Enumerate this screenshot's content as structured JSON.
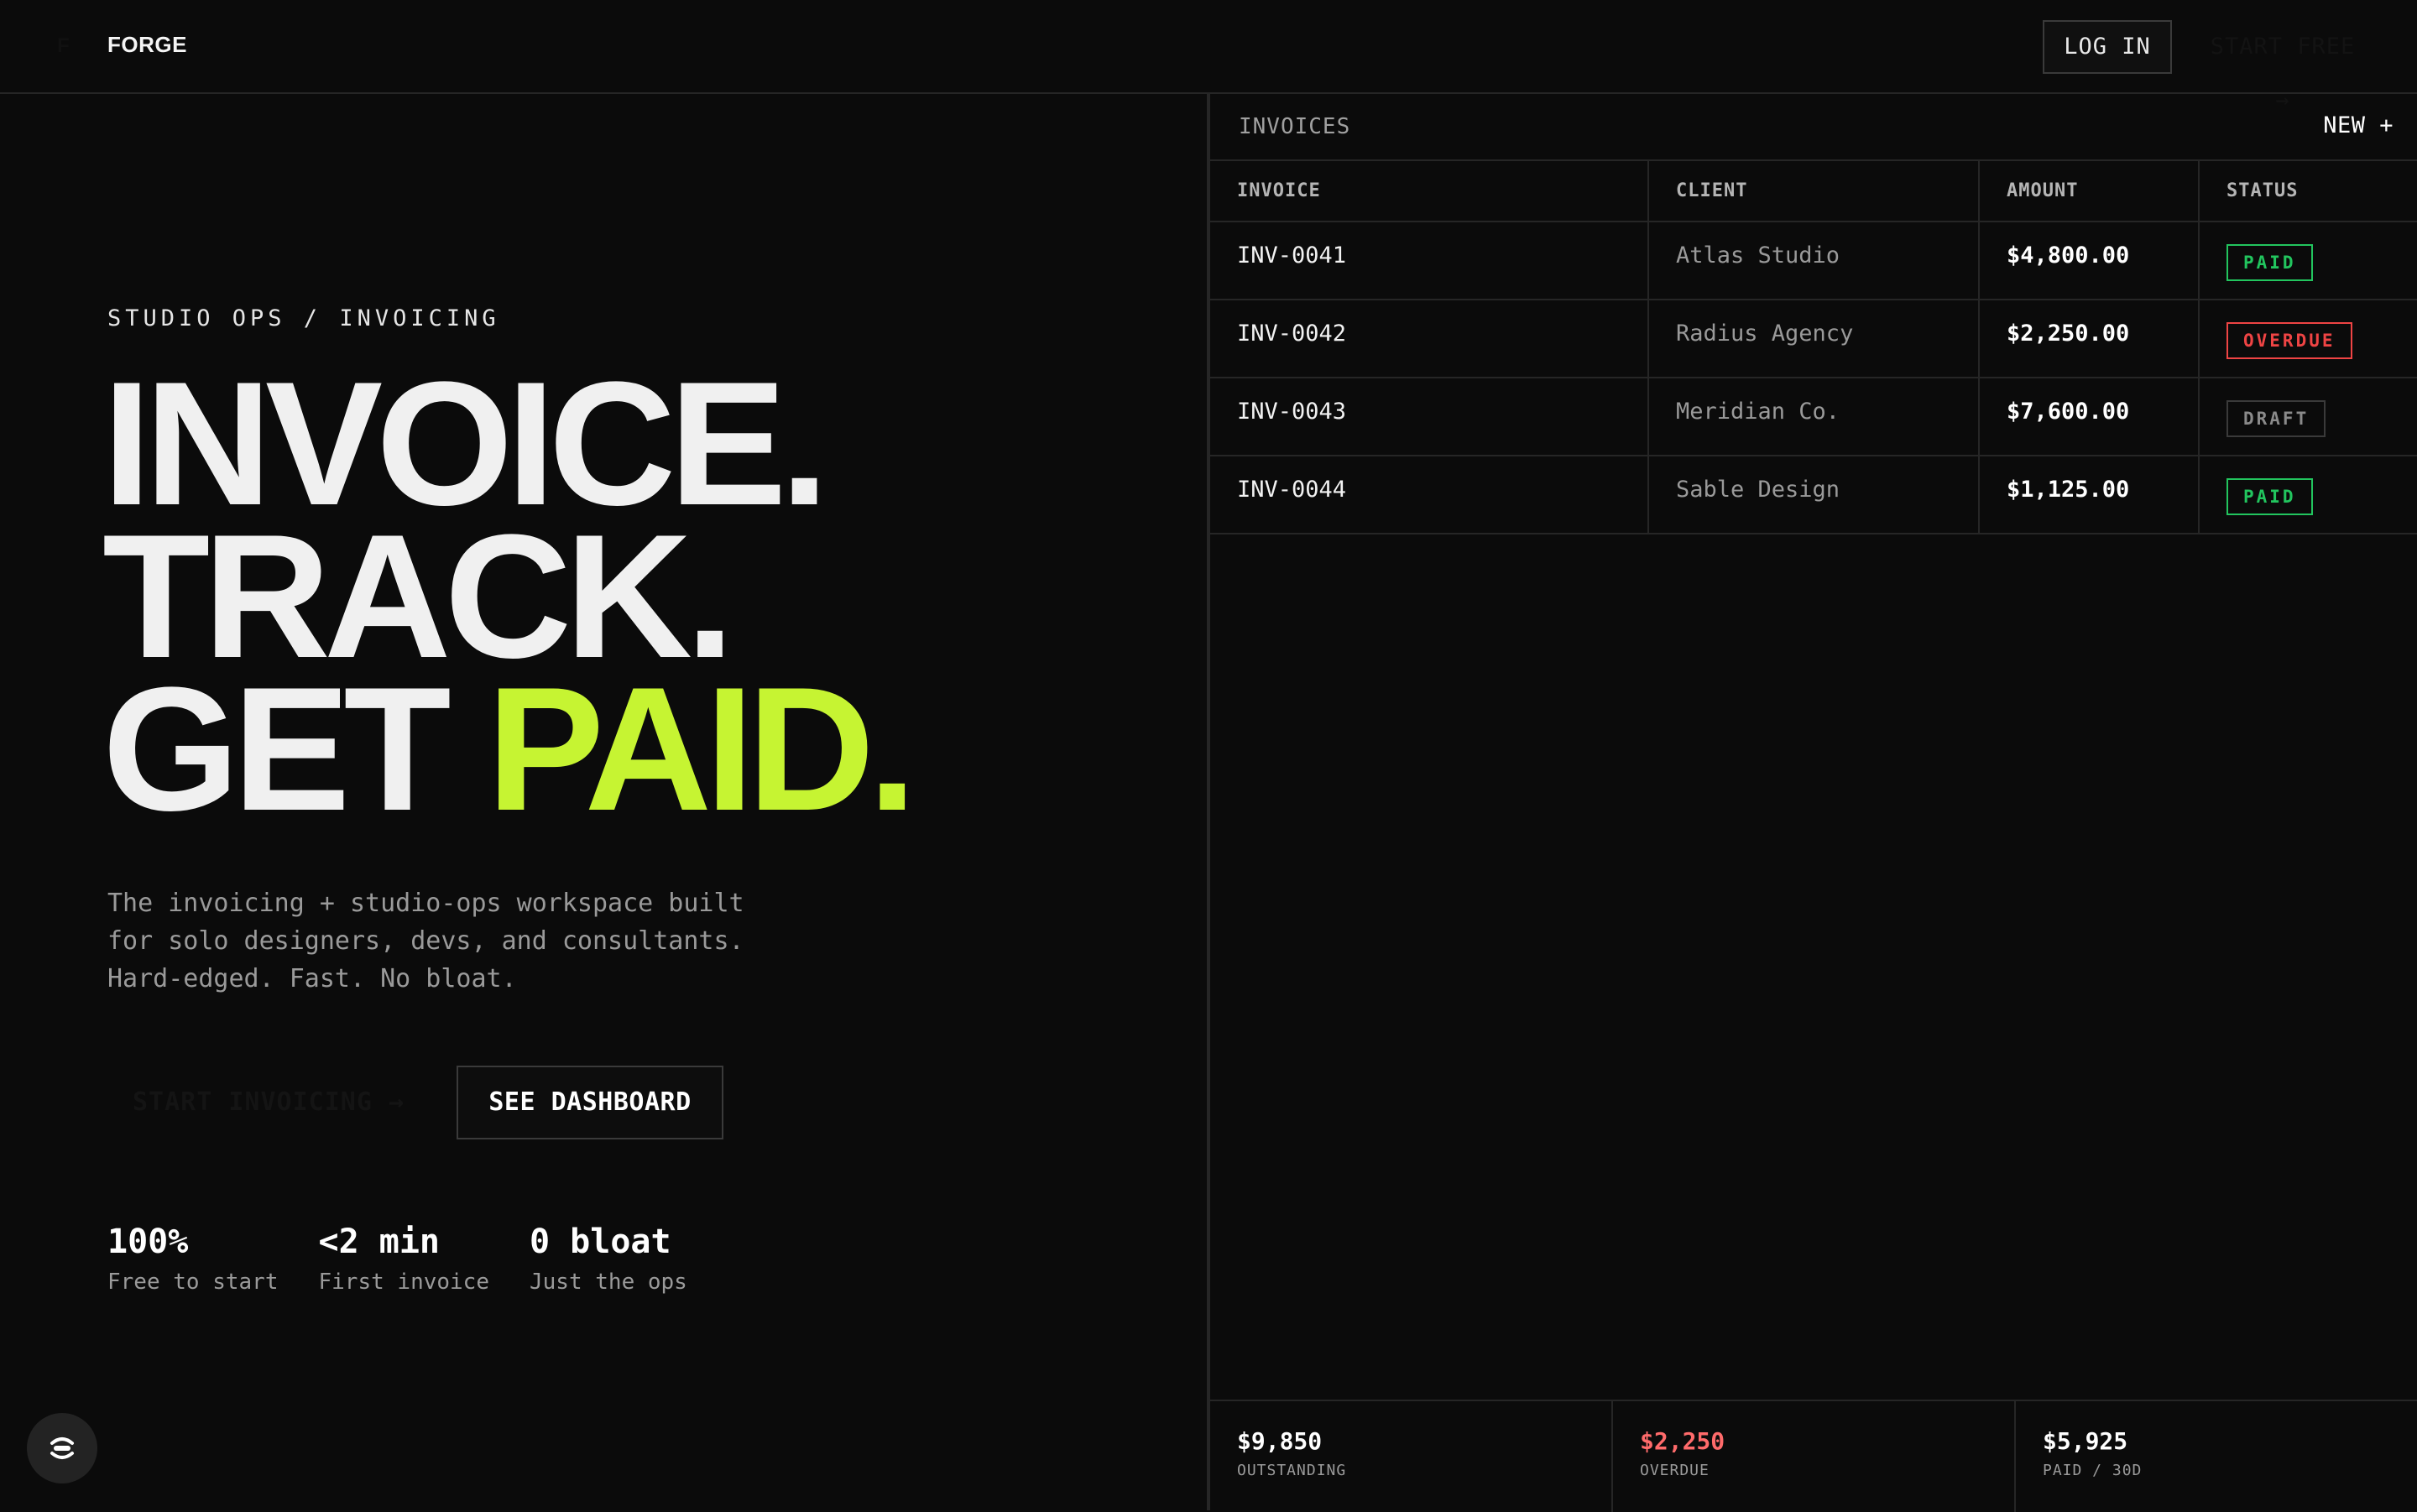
{
  "header": {
    "logo_mark": "F",
    "logo_text": "FORGE",
    "login_label": "LOG IN",
    "start_free_label": "START FREE →"
  },
  "hero": {
    "eyebrow": "STUDIO OPS / INVOICING",
    "headline_line1": "INVOICE.",
    "headline_line2": "TRACK.",
    "headline_line3_prefix": "GET ",
    "headline_line3_accent": "PAID.",
    "subcopy": "The invoicing + studio-ops workspace built for solo designers, devs, and consultants. Hard-edged. Fast. No bloat.",
    "cta_primary": "START INVOICING →",
    "cta_secondary": "SEE DASHBOARD",
    "stats": [
      {
        "value": "100%",
        "label": "Free to start"
      },
      {
        "value": "<2 min",
        "label": "First invoice"
      },
      {
        "value": "0 bloat",
        "label": "Just the ops"
      }
    ]
  },
  "panel": {
    "title": "INVOICES",
    "new_label": "NEW +",
    "columns": [
      "INVOICE",
      "CLIENT",
      "AMOUNT",
      "STATUS"
    ],
    "rows": [
      {
        "invoice": "INV-0041",
        "client": "Atlas Studio",
        "amount": "$4,800.00",
        "status": "PAID"
      },
      {
        "invoice": "INV-0042",
        "client": "Radius Agency",
        "amount": "$2,250.00",
        "status": "OVERDUE"
      },
      {
        "invoice": "INV-0043",
        "client": "Meridian Co.",
        "amount": "$7,600.00",
        "status": "DRAFT"
      },
      {
        "invoice": "INV-0044",
        "client": "Sable Design",
        "amount": "$1,125.00",
        "status": "PAID"
      }
    ],
    "summary": [
      {
        "value": "$9,850",
        "label": "OUTSTANDING"
      },
      {
        "value": "$2,250",
        "label": "OVERDUE"
      },
      {
        "value": "$5,925",
        "label": "PAID / 30D"
      }
    ]
  },
  "colors": {
    "accent": "#c6f432",
    "paid": "#22c55e",
    "overdue": "#ef4444",
    "draft": "#8a8a8a",
    "overdue_value": "#ff6b6b"
  },
  "icons": {
    "fab": "forge-assistant-icon"
  }
}
